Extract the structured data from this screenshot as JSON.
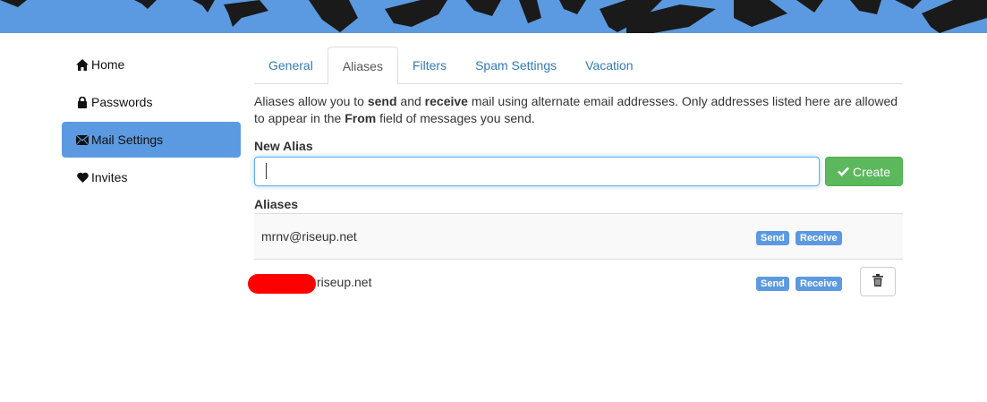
{
  "sidebar": {
    "items": [
      {
        "label": "Home",
        "icon": "home-icon"
      },
      {
        "label": "Passwords",
        "icon": "lock-icon"
      },
      {
        "label": "Mail Settings",
        "icon": "envelope-icon",
        "active": true
      },
      {
        "label": "Invites",
        "icon": "heart-icon"
      }
    ]
  },
  "tabs": [
    {
      "label": "General"
    },
    {
      "label": "Aliases",
      "active": true
    },
    {
      "label": "Filters"
    },
    {
      "label": "Spam Settings"
    },
    {
      "label": "Vacation"
    }
  ],
  "description": {
    "p1": "Aliases allow you to ",
    "send": "send",
    "p2": " and ",
    "receive": "receive",
    "p3": " mail using alternate email addresses. Only addresses listed here are allowed to appear in the ",
    "from": "From",
    "p4": " field of messages you send."
  },
  "new_alias": {
    "label": "New Alias",
    "value": "",
    "create_label": "Create"
  },
  "aliases": {
    "heading": "Aliases",
    "rows": [
      {
        "address": "mrnv@riseup.net",
        "send_label": "Send",
        "receive_label": "Receive"
      },
      {
        "address": "riseup.net",
        "send_label": "Send",
        "receive_label": "Receive",
        "redacted": true,
        "deletable": true
      }
    ]
  },
  "colors": {
    "accent": "#5b9ae0",
    "link": "#337ab7",
    "success": "#5cb85c",
    "redaction": "#ff0000"
  }
}
